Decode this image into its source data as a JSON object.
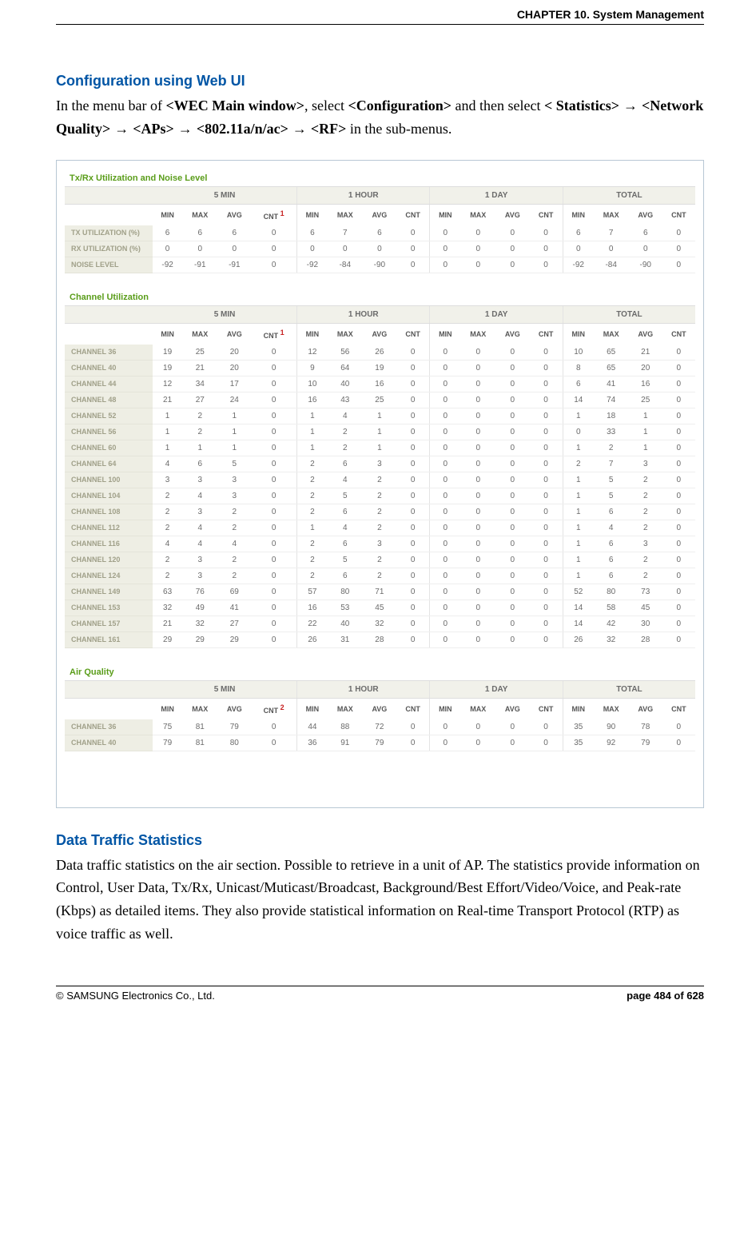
{
  "header": {
    "chapter": "CHAPTER 10. System Management"
  },
  "section1": {
    "title": "Configuration using Web UI",
    "p_prefix": "In the menu bar of ",
    "p_b1": "<WEC Main window>",
    "p_mid1": ", select ",
    "p_b2": "<Configuration>",
    "p_mid2": " and then select ",
    "p_b3": "< Statistics>",
    "arrow": " → ",
    "p_b4": "<Network Quality>",
    "p_b5": "<APs>",
    "p_b6": "<802.11a/n/ac>",
    "p_b7": "<RF>",
    "p_suffix": " in the sub-menus."
  },
  "titles": {
    "txrx": "Tx/Rx Utilization and Noise Level",
    "chan": "Channel Utilization",
    "air": "Air Quality"
  },
  "periods": [
    "5 MIN",
    "1 HOUR",
    "1 DAY",
    "TOTAL"
  ],
  "subcols": [
    "MIN",
    "MAX",
    "AVG",
    "CNT"
  ],
  "sup1": "1",
  "sup2": "2",
  "txrx_rows": [
    {
      "label": "TX UTILIZATION (%)",
      "v": [
        [
          6,
          6,
          6,
          0
        ],
        [
          6,
          7,
          6,
          0
        ],
        [
          0,
          0,
          0,
          0
        ],
        [
          6,
          7,
          6,
          0
        ]
      ]
    },
    {
      "label": "RX UTILIZATION (%)",
      "v": [
        [
          0,
          0,
          0,
          0
        ],
        [
          0,
          0,
          0,
          0
        ],
        [
          0,
          0,
          0,
          0
        ],
        [
          0,
          0,
          0,
          0
        ]
      ]
    },
    {
      "label": "NOISE LEVEL",
      "v": [
        [
          -92,
          -91,
          -91,
          0
        ],
        [
          -92,
          -84,
          -90,
          0
        ],
        [
          0,
          0,
          0,
          0
        ],
        [
          -92,
          -84,
          -90,
          0
        ]
      ]
    }
  ],
  "chan_rows": [
    {
      "label": "CHANNEL 36",
      "v": [
        [
          19,
          25,
          20,
          0
        ],
        [
          12,
          56,
          26,
          0
        ],
        [
          0,
          0,
          0,
          0
        ],
        [
          10,
          65,
          21,
          0
        ]
      ]
    },
    {
      "label": "CHANNEL 40",
      "v": [
        [
          19,
          21,
          20,
          0
        ],
        [
          9,
          64,
          19,
          0
        ],
        [
          0,
          0,
          0,
          0
        ],
        [
          8,
          65,
          20,
          0
        ]
      ]
    },
    {
      "label": "CHANNEL 44",
      "v": [
        [
          12,
          34,
          17,
          0
        ],
        [
          10,
          40,
          16,
          0
        ],
        [
          0,
          0,
          0,
          0
        ],
        [
          6,
          41,
          16,
          0
        ]
      ]
    },
    {
      "label": "CHANNEL 48",
      "v": [
        [
          21,
          27,
          24,
          0
        ],
        [
          16,
          43,
          25,
          0
        ],
        [
          0,
          0,
          0,
          0
        ],
        [
          14,
          74,
          25,
          0
        ]
      ]
    },
    {
      "label": "CHANNEL 52",
      "v": [
        [
          1,
          2,
          1,
          0
        ],
        [
          1,
          4,
          1,
          0
        ],
        [
          0,
          0,
          0,
          0
        ],
        [
          1,
          18,
          1,
          0
        ]
      ]
    },
    {
      "label": "CHANNEL 56",
      "v": [
        [
          1,
          2,
          1,
          0
        ],
        [
          1,
          2,
          1,
          0
        ],
        [
          0,
          0,
          0,
          0
        ],
        [
          0,
          33,
          1,
          0
        ]
      ]
    },
    {
      "label": "CHANNEL 60",
      "v": [
        [
          1,
          1,
          1,
          0
        ],
        [
          1,
          2,
          1,
          0
        ],
        [
          0,
          0,
          0,
          0
        ],
        [
          1,
          2,
          1,
          0
        ]
      ]
    },
    {
      "label": "CHANNEL 64",
      "v": [
        [
          4,
          6,
          5,
          0
        ],
        [
          2,
          6,
          3,
          0
        ],
        [
          0,
          0,
          0,
          0
        ],
        [
          2,
          7,
          3,
          0
        ]
      ]
    },
    {
      "label": "CHANNEL 100",
      "v": [
        [
          3,
          3,
          3,
          0
        ],
        [
          2,
          4,
          2,
          0
        ],
        [
          0,
          0,
          0,
          0
        ],
        [
          1,
          5,
          2,
          0
        ]
      ]
    },
    {
      "label": "CHANNEL 104",
      "v": [
        [
          2,
          4,
          3,
          0
        ],
        [
          2,
          5,
          2,
          0
        ],
        [
          0,
          0,
          0,
          0
        ],
        [
          1,
          5,
          2,
          0
        ]
      ]
    },
    {
      "label": "CHANNEL 108",
      "v": [
        [
          2,
          3,
          2,
          0
        ],
        [
          2,
          6,
          2,
          0
        ],
        [
          0,
          0,
          0,
          0
        ],
        [
          1,
          6,
          2,
          0
        ]
      ]
    },
    {
      "label": "CHANNEL 112",
      "v": [
        [
          2,
          4,
          2,
          0
        ],
        [
          1,
          4,
          2,
          0
        ],
        [
          0,
          0,
          0,
          0
        ],
        [
          1,
          4,
          2,
          0
        ]
      ]
    },
    {
      "label": "CHANNEL 116",
      "v": [
        [
          4,
          4,
          4,
          0
        ],
        [
          2,
          6,
          3,
          0
        ],
        [
          0,
          0,
          0,
          0
        ],
        [
          1,
          6,
          3,
          0
        ]
      ]
    },
    {
      "label": "CHANNEL 120",
      "v": [
        [
          2,
          3,
          2,
          0
        ],
        [
          2,
          5,
          2,
          0
        ],
        [
          0,
          0,
          0,
          0
        ],
        [
          1,
          6,
          2,
          0
        ]
      ]
    },
    {
      "label": "CHANNEL 124",
      "v": [
        [
          2,
          3,
          2,
          0
        ],
        [
          2,
          6,
          2,
          0
        ],
        [
          0,
          0,
          0,
          0
        ],
        [
          1,
          6,
          2,
          0
        ]
      ]
    },
    {
      "label": "CHANNEL 149",
      "v": [
        [
          63,
          76,
          69,
          0
        ],
        [
          57,
          80,
          71,
          0
        ],
        [
          0,
          0,
          0,
          0
        ],
        [
          52,
          80,
          73,
          0
        ]
      ]
    },
    {
      "label": "CHANNEL 153",
      "v": [
        [
          32,
          49,
          41,
          0
        ],
        [
          16,
          53,
          45,
          0
        ],
        [
          0,
          0,
          0,
          0
        ],
        [
          14,
          58,
          45,
          0
        ]
      ]
    },
    {
      "label": "CHANNEL 157",
      "v": [
        [
          21,
          32,
          27,
          0
        ],
        [
          22,
          40,
          32,
          0
        ],
        [
          0,
          0,
          0,
          0
        ],
        [
          14,
          42,
          30,
          0
        ]
      ]
    },
    {
      "label": "CHANNEL 161",
      "v": [
        [
          29,
          29,
          29,
          0
        ],
        [
          26,
          31,
          28,
          0
        ],
        [
          0,
          0,
          0,
          0
        ],
        [
          26,
          32,
          28,
          0
        ]
      ]
    }
  ],
  "air_rows": [
    {
      "label": "CHANNEL 36",
      "v": [
        [
          75,
          81,
          79,
          0
        ],
        [
          44,
          88,
          72,
          0
        ],
        [
          0,
          0,
          0,
          0
        ],
        [
          35,
          90,
          78,
          0
        ]
      ]
    },
    {
      "label": "CHANNEL 40",
      "v": [
        [
          79,
          81,
          80,
          0
        ],
        [
          36,
          91,
          79,
          0
        ],
        [
          0,
          0,
          0,
          0
        ],
        [
          35,
          92,
          79,
          0
        ]
      ]
    }
  ],
  "section2": {
    "title": "Data Traffic Statistics",
    "body": "Data traffic statistics on the air section. Possible to retrieve in a unit of AP. The statistics provide information on Control, User Data, Tx/Rx, Unicast/Muticast/Broadcast, Background/Best Effort/Video/Voice, and Peak-rate (Kbps) as detailed items. They also provide statistical information on Real-time Transport Protocol (RTP) as voice traffic as well."
  },
  "footer": {
    "copyright": "© SAMSUNG Electronics Co., Ltd.",
    "page": "page 484 of 628"
  }
}
